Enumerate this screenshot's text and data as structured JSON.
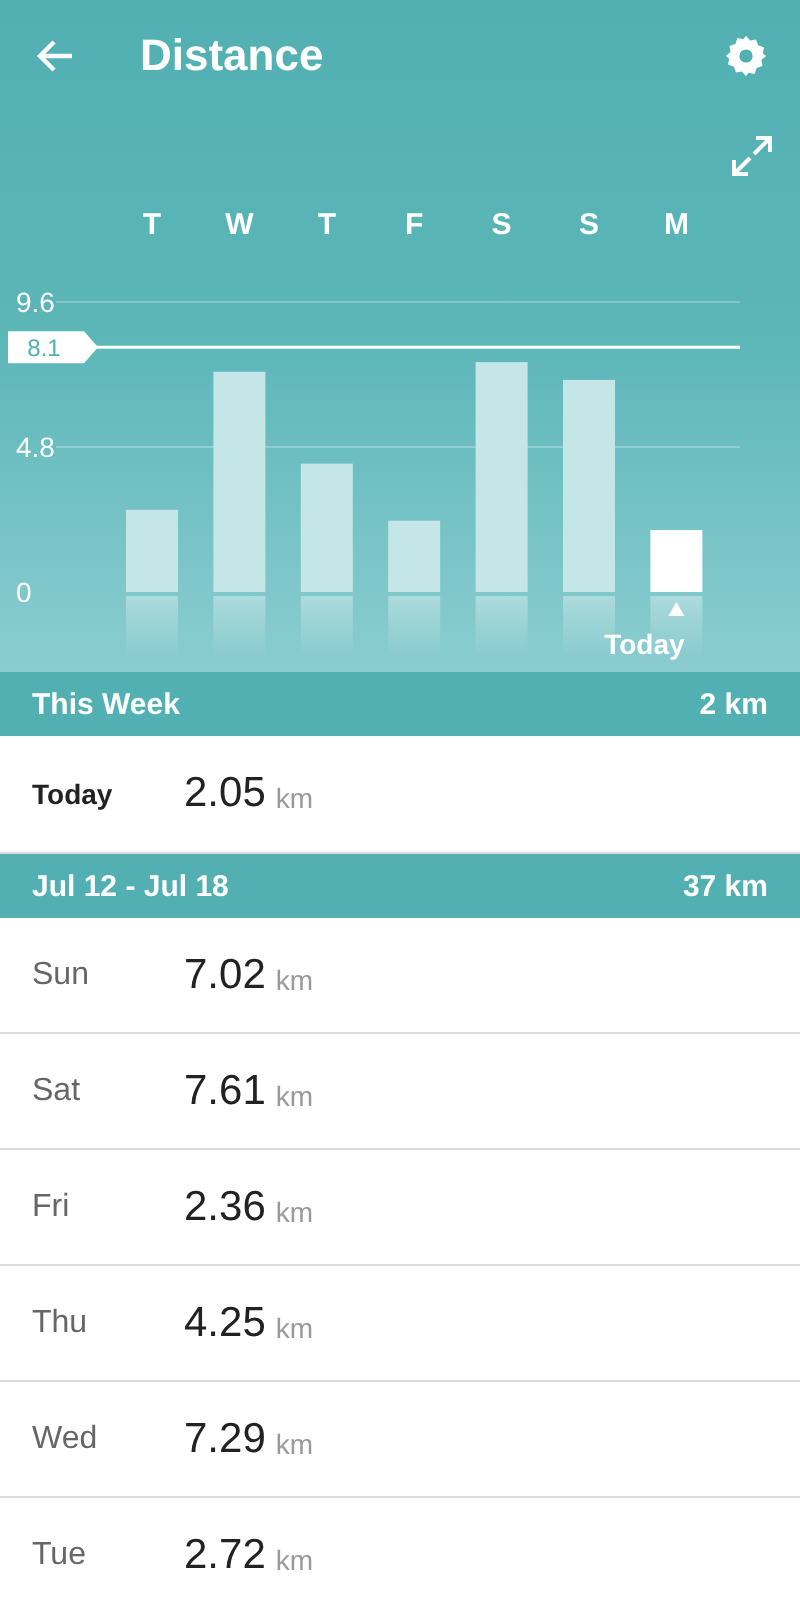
{
  "header": {
    "title": "Distance"
  },
  "chart": {
    "chart_data": {
      "type": "bar",
      "categories": [
        "T",
        "W",
        "T",
        "F",
        "S",
        "S",
        "M"
      ],
      "series": [
        {
          "color": "#c4e6e7",
          "values": [
            2.72,
            7.29,
            4.25,
            2.36,
            7.61,
            7.02,
            null
          ]
        },
        {
          "color": "#ffffff",
          "values": [
            null,
            null,
            null,
            null,
            null,
            null,
            2.05
          ]
        }
      ],
      "ylim": [
        0,
        9.6
      ],
      "yticks": [
        0,
        4.8,
        9.6
      ],
      "ref_lines": [
        {
          "axis": "y",
          "value": 8.1,
          "label": "8.1"
        }
      ],
      "annotations": [
        "Today"
      ]
    }
  },
  "sections": [
    {
      "title": "This Week",
      "total": "2 km",
      "rows": [
        {
          "day": "Today",
          "value": "2.05",
          "unit": "km",
          "kind": "today"
        }
      ]
    },
    {
      "title": "Jul 12 - Jul 18",
      "total": "37 km",
      "rows": [
        {
          "day": "Sun",
          "value": "7.02",
          "unit": "km",
          "kind": "day"
        },
        {
          "day": "Sat",
          "value": "7.61",
          "unit": "km",
          "kind": "day"
        },
        {
          "day": "Fri",
          "value": "2.36",
          "unit": "km",
          "kind": "day"
        },
        {
          "day": "Thu",
          "value": "4.25",
          "unit": "km",
          "kind": "day"
        },
        {
          "day": "Wed",
          "value": "7.29",
          "unit": "km",
          "kind": "day"
        },
        {
          "day": "Tue",
          "value": "2.72",
          "unit": "km",
          "kind": "day"
        }
      ]
    }
  ]
}
